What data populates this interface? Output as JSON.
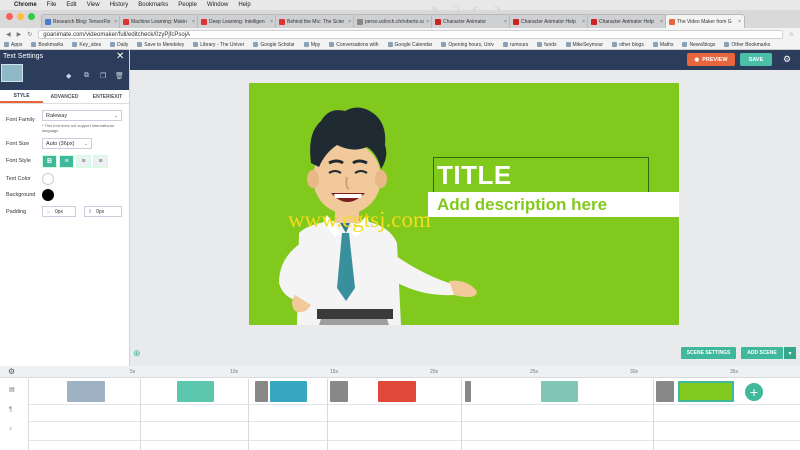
{
  "mac_menu": {
    "apple": "",
    "items": [
      "Chrome",
      "File",
      "Edit",
      "View",
      "History",
      "Bookmarks",
      "People",
      "Window",
      "Help"
    ]
  },
  "browser_tabs": [
    {
      "label": "Research Blog: TensorFlo",
      "color": "#4a7bd0"
    },
    {
      "label": "Machine Learning: Makin",
      "color": "#d33"
    },
    {
      "label": "Deep Learning: Intelligen",
      "color": "#d33"
    },
    {
      "label": "Behind the Mic: The Scier",
      "color": "#d33"
    },
    {
      "label": "perso.uclinch.ch/roberto.cal",
      "color": "#888"
    },
    {
      "label": "Character Animator",
      "color": "#c22"
    },
    {
      "label": "Character Animator Help",
      "color": "#c22"
    },
    {
      "label": "Character Animator Help",
      "color": "#c22"
    },
    {
      "label": "The Video Maker from G",
      "color": "#e8663d",
      "active": true
    }
  ],
  "address": {
    "url": "goanimate.com/videomaker/full/editcheck/0zyPjfcPsojA"
  },
  "bookmarks": [
    "Apps",
    "Bookmarks",
    "Key_sites",
    "Daily",
    "Save to Mendeley",
    "Library - The Univer",
    "Google Scholar",
    "Mpy",
    "Conversations with",
    "Google Calendar",
    "Opening hours, Univ",
    "rumours",
    "funds",
    "MikeSeymour",
    "other blogs",
    "Maths",
    "News/blogs",
    "Other Bookmarks"
  ],
  "header": {
    "preview_label": "PREVIEW",
    "save_label": "SAVE"
  },
  "panel": {
    "title": "Text Settings",
    "tabs": [
      "STYLE",
      "ADVANCED",
      "ENTER/EXIT"
    ],
    "font_family_label": "Font Family",
    "font_family_value": "Raleway",
    "font_note": "* This font does not support international language",
    "font_size_label": "Font Size",
    "font_size_value": "Auto (36px)",
    "font_style_label": "Font Style",
    "text_color_label": "Text Color",
    "background_label": "Background",
    "padding_label": "Padding",
    "padding_h_value": "0px",
    "padding_v_value": "0px",
    "style_buttons": {
      "bold": "B",
      "align": "≡",
      "align2": "≡",
      "align3": "≡"
    }
  },
  "scene": {
    "title": "TITLE",
    "description": "Add description here",
    "watermark": "www.cgtsj.com",
    "background": "#82c91e"
  },
  "scene_buttons": {
    "settings_label": "SCENE SETTINGS",
    "add_label": "ADD SCENE"
  },
  "timeline": {
    "ticks": [
      "5s",
      "10s",
      "15s",
      "20s",
      "25s",
      "30s",
      "35s"
    ]
  },
  "colors": {
    "accent": "#3fb89b",
    "header": "#2b3d5a",
    "preview": "#e8663d",
    "scene_green": "#82c91e"
  }
}
